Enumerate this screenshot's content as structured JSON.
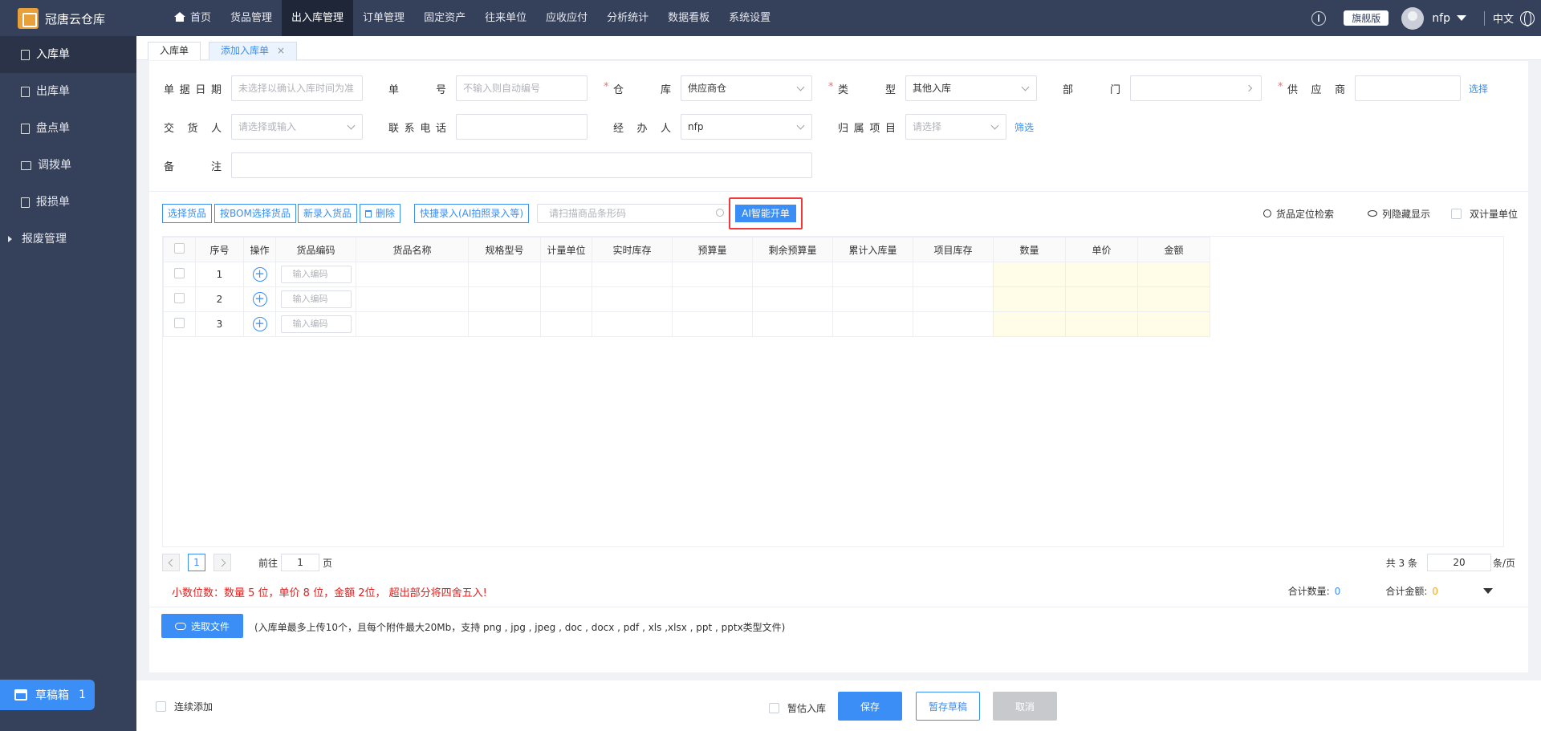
{
  "app": {
    "title": "冠唐云仓库"
  },
  "topnav": {
    "items": [
      "首页",
      "货品管理",
      "出入库管理",
      "订单管理",
      "固定资产",
      "往来单位",
      "应收应付",
      "分析统计",
      "数据看板",
      "系统设置"
    ],
    "active": "出入库管理"
  },
  "topright": {
    "edition": "旗舰版",
    "user": "nfp",
    "lang": "中文"
  },
  "sidebar": {
    "items": [
      "入库单",
      "出库单",
      "盘点单",
      "调拨单",
      "报损单",
      "报废管理"
    ],
    "draft_label": "草稿箱",
    "draft_count": "1"
  },
  "tabs": {
    "t0": "入库单",
    "t1": "添加入库单",
    "close": "×"
  },
  "form": {
    "date_label": "单据日期",
    "date_placeholder": "未选择以确认入库时间为准",
    "no_label": "单号",
    "no_placeholder": "不输入则自动编号",
    "warehouse_label": "仓库",
    "warehouse_value": "供应商仓",
    "type_label": "类型",
    "type_value": "其他入库",
    "dept_label": "部门",
    "dept_value": "",
    "supplier_label": "供应商",
    "supplier_value": "",
    "supplier_link": "选择",
    "deliverer_label": "交货人",
    "deliverer_placeholder": "请选择或输入",
    "phone_label": "联系电话",
    "phone_value": "",
    "handler_label": "经办人",
    "handler_value": "nfp",
    "project_label": "归属项目",
    "project_placeholder": "请选择",
    "project_link": "筛选",
    "remark_label": "备注",
    "remark_value": ""
  },
  "toolbar": {
    "select_goods": "选择货品",
    "bom_select": "按BOM选择货品",
    "new_goods": "新录入货品",
    "delete": "删除",
    "quick_entry": "快捷录入(AI拍照录入等)",
    "scan_placeholder": "请扫描商品条形码",
    "ai_button": "AI智能开单",
    "locate": "货品定位检索",
    "columns": "列隐藏显示",
    "dual_unit": "双计量单位"
  },
  "table": {
    "headers": [
      "",
      "序号",
      "操作",
      "货品编码",
      "货品名称",
      "规格型号",
      "计量单位",
      "实时库存",
      "预算量",
      "剩余预算量",
      "累计入库量",
      "项目库存",
      "数量",
      "单价",
      "金额"
    ],
    "rows": [
      "1",
      "2",
      "3"
    ],
    "plus": "+",
    "code_placeholder": "输入编码"
  },
  "pager": {
    "page": "1",
    "goto_label": "前往",
    "goto_value": "1",
    "page_unit": "页",
    "total": "共 3 条",
    "size": "20",
    "size_unit": "条/页"
  },
  "notes": {
    "decimal": "小数位数：数量 5 位，单价 8 位，金额 2位， 超出部分将四舍五入!",
    "total_qty_label": "合计数量:",
    "total_qty": "0",
    "total_amt_label": "合计金额:",
    "total_amt": "0"
  },
  "upload": {
    "button": "选取文件",
    "note": "(入库单最多上传10个，且每个附件最大20Mb，支持 png , jpg , jpeg , doc , docx , pdf , xls ,xlsx , ppt , pptx类型文件)"
  },
  "footer": {
    "continuous": "连续添加",
    "estimate": "暂估入库",
    "save": "保存",
    "save_draft": "暂存草稿",
    "cancel": "取消"
  }
}
